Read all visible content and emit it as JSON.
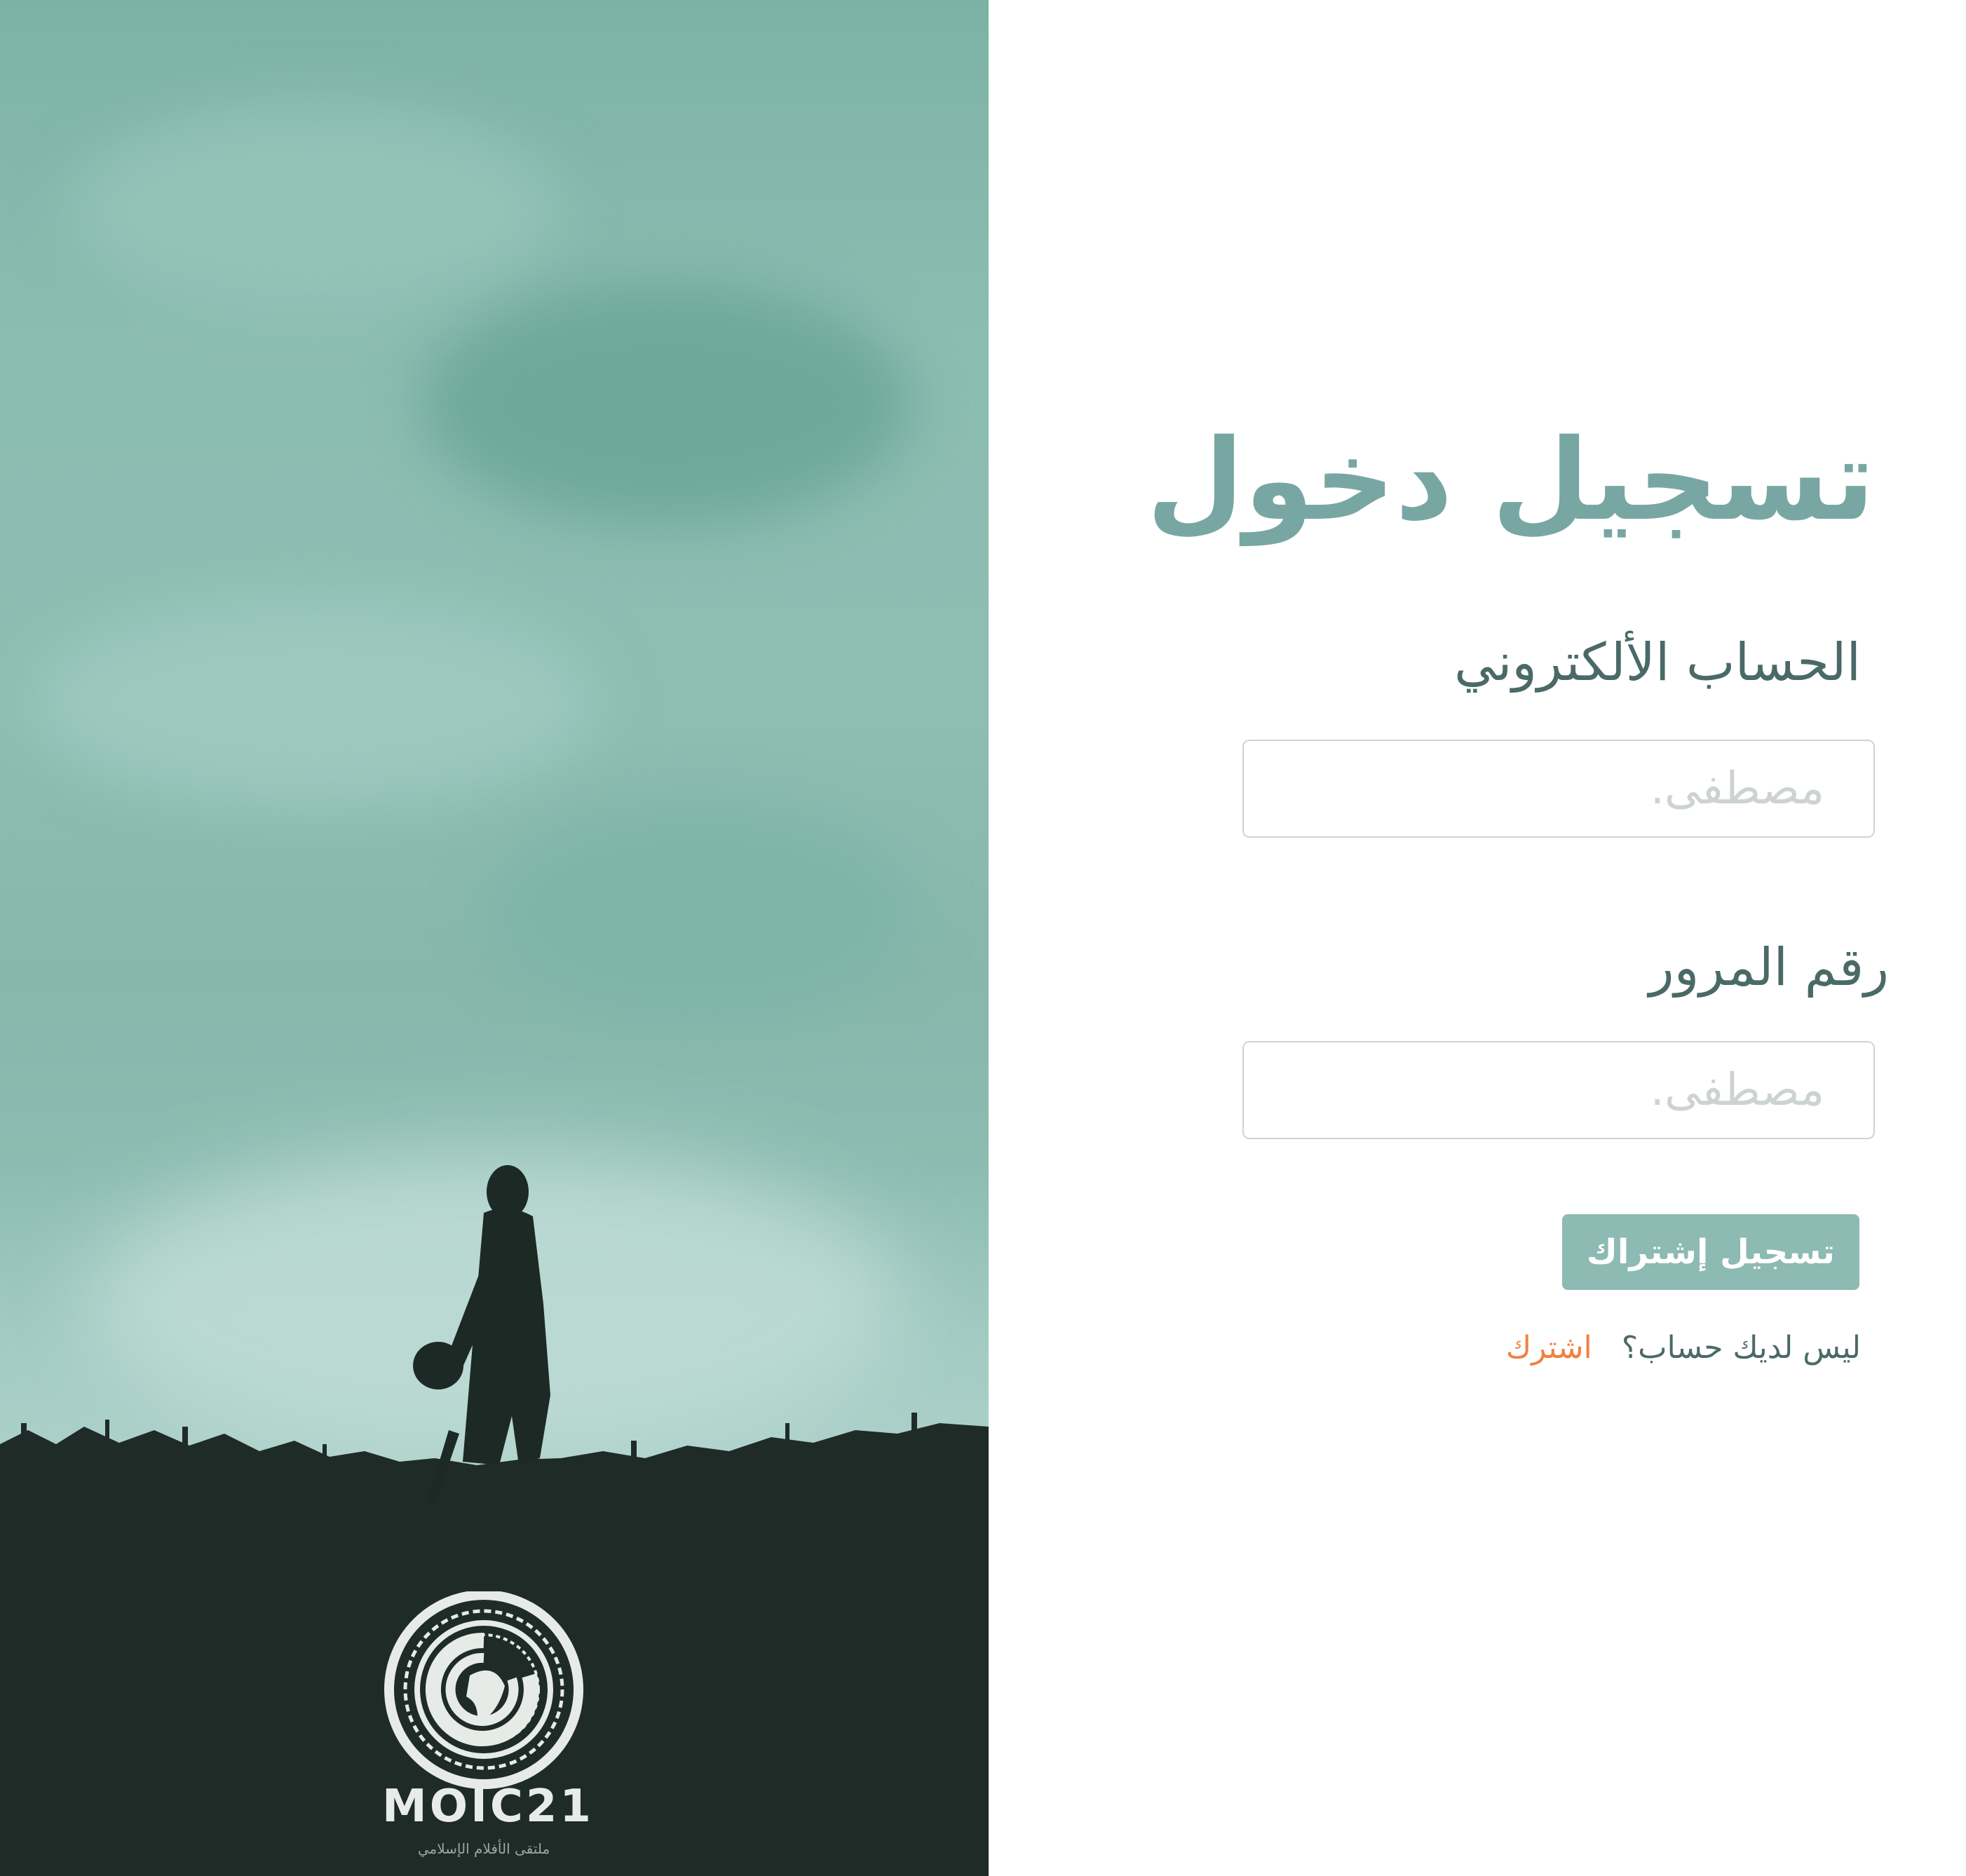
{
  "hero": {
    "logo_text": "MOIC21",
    "logo_subtext": "ملتقى الأفلام الإسلامي"
  },
  "form": {
    "title": "تسجيل دخول",
    "email_label": "الحساب الألكتروني",
    "email_placeholder": "مصطفى.",
    "password_label": "رقم المرور",
    "password_placeholder": "مصطفى.",
    "submit_label": "تسجيل إشتراك",
    "signup_prompt": "ليس لديك حساب؟",
    "signup_link": "اشترك"
  },
  "colors": {
    "accent": "#78a7a3",
    "button": "#8dbab2",
    "link": "#f0813e",
    "label": "#4a6a67"
  }
}
